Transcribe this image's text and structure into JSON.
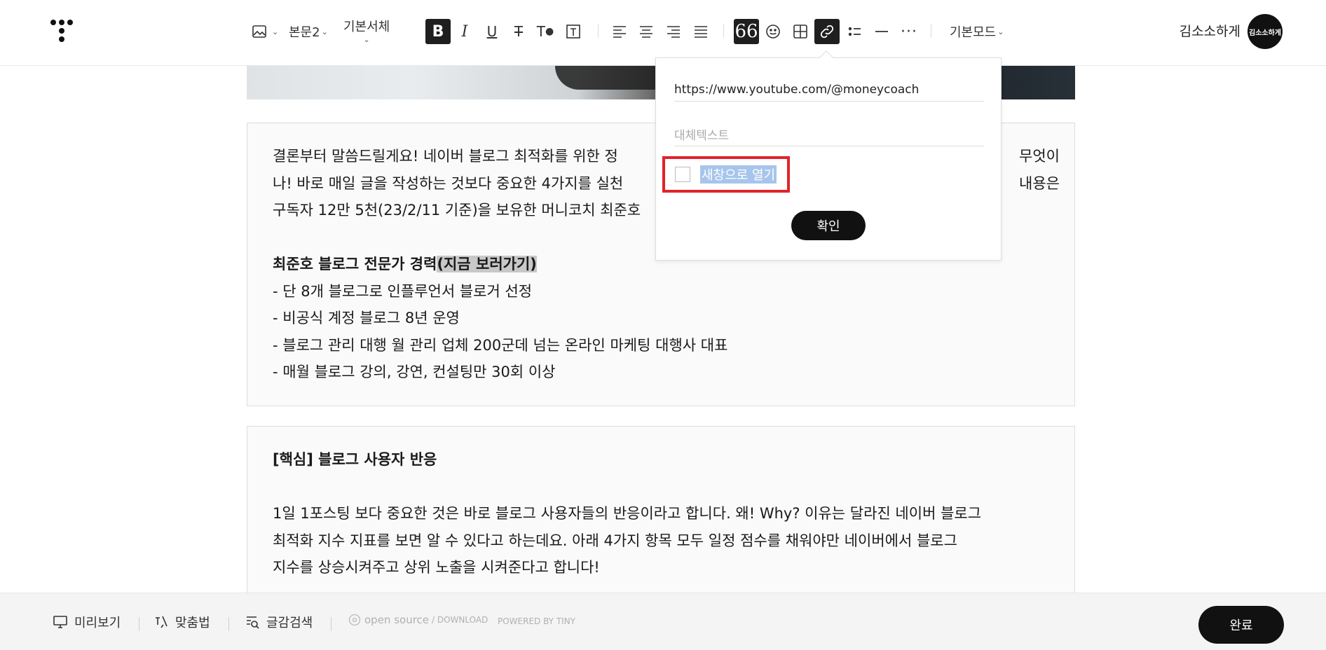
{
  "toolbar": {
    "paragraph_style": "본문2",
    "font_family": "기본서체",
    "mode": "기본모드"
  },
  "user": {
    "name": "김소소하게",
    "avatar_text": "김소소하게"
  },
  "link_popup": {
    "url_value": "https://www.youtube.com/@moneycoach",
    "alt_placeholder": "대체텍스트",
    "new_window_label": "새창으로 열기",
    "confirm_label": "확인"
  },
  "content": {
    "box1": {
      "lines": [
        "결론부터 말씀드릴게요! 네이버 블로그 최적화를 위한 정",
        "나! 바로 매일 글을 작성하는 것보다 중요한 4가지를 실천",
        "구독자 12만 5천(23/2/11 기준)을 보유한 머니코치 최준호"
      ],
      "line1_tail": "무엇이",
      "line2_tail": "내용은",
      "career_title": "최준호 블로그 전문가 경력",
      "career_link": "(지금 보러가기)",
      "career_items": [
        "- 단 8개 블로그로 인플루언서 블로거 선정",
        "- 비공식 계정 블로그 8년 운영",
        "- 블로그 관리 대행 월 관리 업체 200군데 넘는 온라인 마케팅 대행사 대표",
        "- 매월 블로그 강의, 강연, 컨설팅만 30회 이상"
      ]
    },
    "box2": {
      "heading": "[핵심] 블로그 사용자 반응",
      "lines": [
        "1일 1포스팅 보다 중요한 것은 바로 블로그 사용자들의 반응이라고 합니다. 왜! Why? 이유는 달라진 네이버 블로그",
        "최적화 지수 지표를 보면 알 수 있다고 하는데요. 아래 4가지 항목 모두 일정 점수를 채워야만 네이버에서 블로그",
        "지수를 상승시켜주고 상위 노출을 시켜준다고 합니다!"
      ]
    }
  },
  "bottombar": {
    "preview": "미리보기",
    "spellcheck": "맞춤법",
    "material_search": "글감검색",
    "open_source": "open source",
    "download": "/ DOWNLOAD",
    "powered": "POWERED BY TINY",
    "done": "완료"
  }
}
